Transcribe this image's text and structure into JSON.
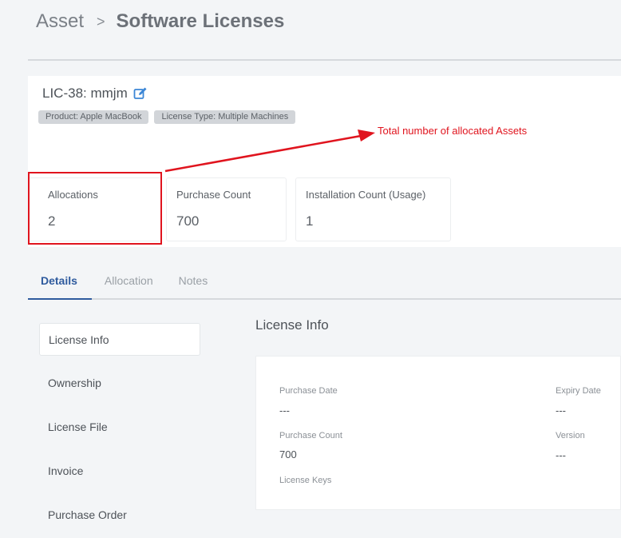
{
  "breadcrumb": {
    "root": "Asset",
    "separator": ">",
    "current": "Software Licenses"
  },
  "license": {
    "title": "LIC-38: mmjm",
    "tags": [
      "Product: Apple MacBook",
      "License Type: Multiple Machines"
    ]
  },
  "annotation": {
    "text": "Total number of allocated Assets",
    "color": "#e0141e"
  },
  "stats": [
    {
      "label": "Allocations",
      "value": "2"
    },
    {
      "label": "Purchase Count",
      "value": "700"
    },
    {
      "label": "Installation Count (Usage)",
      "value": "1"
    }
  ],
  "tabs": [
    {
      "label": "Details",
      "active": true
    },
    {
      "label": "Allocation",
      "active": false
    },
    {
      "label": "Notes",
      "active": false
    }
  ],
  "sidebar": {
    "items": [
      {
        "label": "License Info",
        "active": true
      },
      {
        "label": "Ownership",
        "active": false
      },
      {
        "label": "License File",
        "active": false
      },
      {
        "label": "Invoice",
        "active": false
      },
      {
        "label": "Purchase Order",
        "active": false
      }
    ]
  },
  "license_info": {
    "title": "License Info",
    "fields": [
      {
        "label": "Purchase Date",
        "value": "---"
      },
      {
        "label": "Expiry Date",
        "value": "---"
      },
      {
        "label": "Purchase Count",
        "value": "700"
      },
      {
        "label": "Version",
        "value": "---"
      },
      {
        "label": "License Keys",
        "value": ""
      }
    ]
  },
  "colors": {
    "accent": "#2f5b9e",
    "annotation": "#e0141e",
    "edit_icon": "#3b86d6"
  },
  "icons": {
    "edit": "edit-icon"
  }
}
